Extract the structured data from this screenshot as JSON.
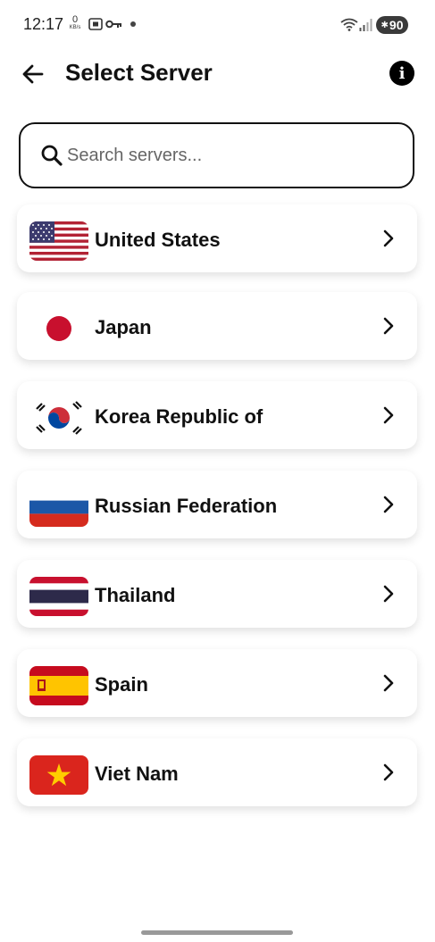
{
  "status_bar": {
    "time": "12:17",
    "net_speed_value": "0",
    "net_speed_unit": "KB/s",
    "battery": "90"
  },
  "header": {
    "title": "Select Server",
    "back_icon": "arrow-left-icon",
    "info_icon": "info-icon",
    "info_glyph": "i"
  },
  "search": {
    "placeholder": "Search servers...",
    "value": ""
  },
  "servers": [
    {
      "name": "United States",
      "flag": "us-flag-icon"
    },
    {
      "name": "Japan",
      "flag": "japan-flag-icon"
    },
    {
      "name": "Korea Republic of",
      "flag": "korea-flag-icon"
    },
    {
      "name": "Russian Federation",
      "flag": "russia-flag-icon"
    },
    {
      "name": "Thailand",
      "flag": "thailand-flag-icon"
    },
    {
      "name": "Spain",
      "flag": "spain-flag-icon"
    },
    {
      "name": "Viet Nam",
      "flag": "vietnam-flag-icon"
    }
  ],
  "colors": {
    "text": "#111111",
    "card_shadow": "#e0e0e0"
  }
}
